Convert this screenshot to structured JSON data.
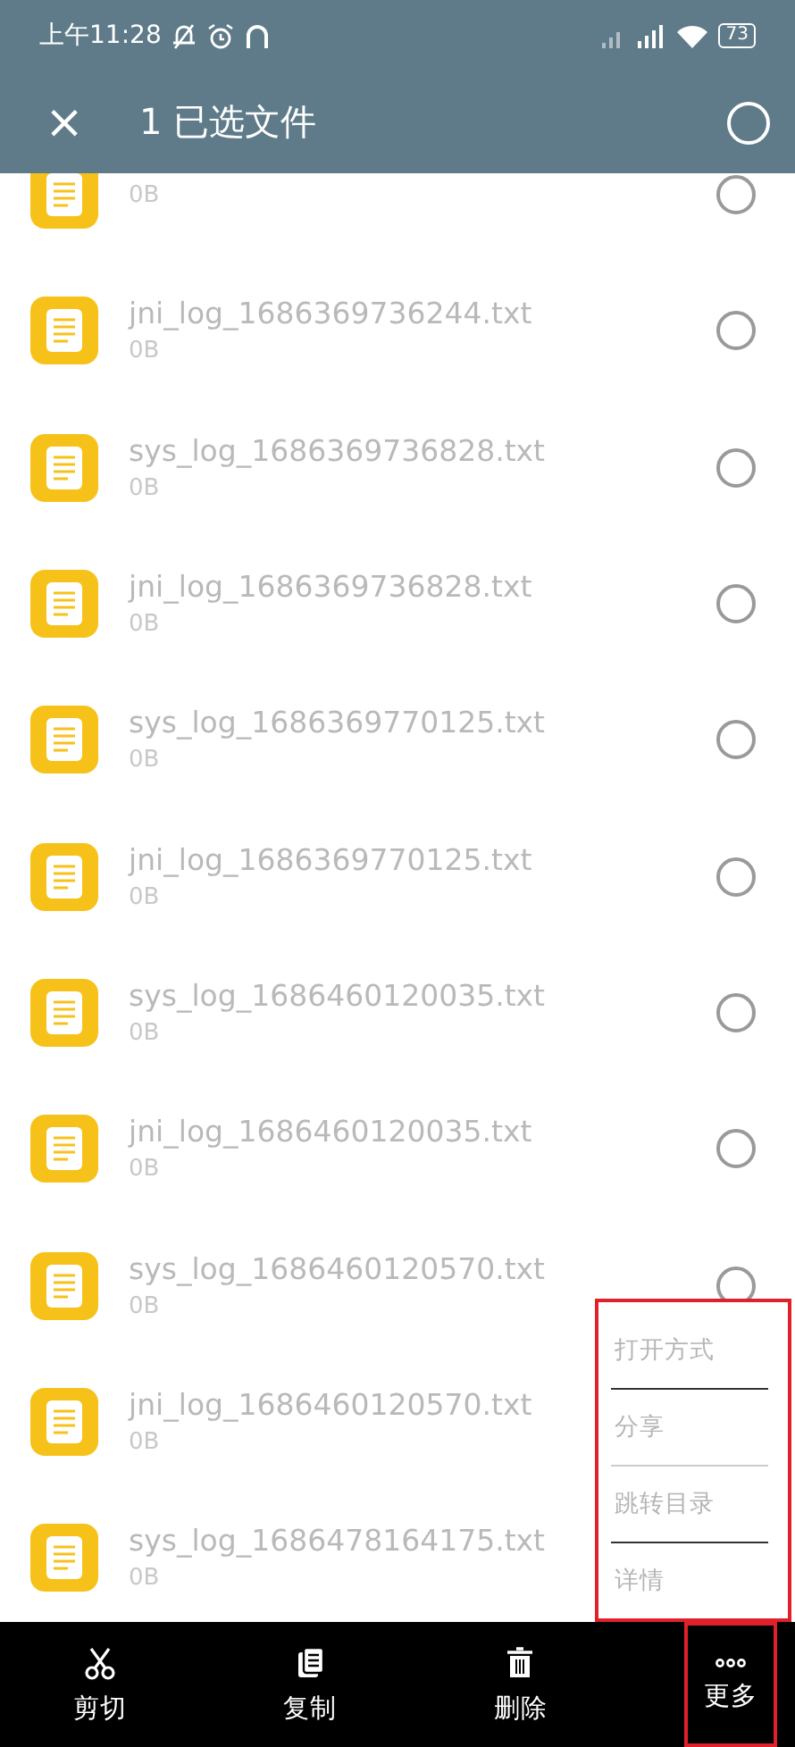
{
  "status_bar": {
    "time": "上午11:28",
    "battery": "73"
  },
  "toolbar": {
    "close": "×",
    "title": "1 已选文件"
  },
  "files": [
    {
      "size": "0B",
      "selected": false
    },
    {
      "name": "jni_log_1686369736244.txt",
      "size": "0B",
      "selected": false
    },
    {
      "name": "sys_log_1686369736828.txt",
      "size": "0B",
      "selected": false
    },
    {
      "name": "jni_log_1686369736828.txt",
      "size": "0B",
      "selected": false
    },
    {
      "name": "sys_log_1686369770125.txt",
      "size": "0B",
      "selected": false
    },
    {
      "name": "jni_log_1686369770125.txt",
      "size": "0B",
      "selected": false
    },
    {
      "name": "sys_log_1686460120035.txt",
      "size": "0B",
      "selected": false
    },
    {
      "name": "jni_log_1686460120035.txt",
      "size": "0B",
      "selected": false
    },
    {
      "name": "sys_log_1686460120570.txt",
      "size": "0B",
      "selected": false
    },
    {
      "name": "jni_log_1686460120570.txt",
      "size": "0B"
    },
    {
      "name": "sys_log_1686478164175.txt",
      "size": "0B"
    }
  ],
  "menu": {
    "highlighted": true,
    "items": [
      "打开方式",
      "分享",
      "跳转目录",
      "详情"
    ]
  },
  "actions": [
    {
      "kind": "cut",
      "label": "剪切",
      "highlighted": false
    },
    {
      "kind": "copy",
      "label": "复制",
      "highlighted": false
    },
    {
      "kind": "delete",
      "label": "删除",
      "highlighted": false
    },
    {
      "kind": "more",
      "label": "更多",
      "highlighted": true
    }
  ]
}
